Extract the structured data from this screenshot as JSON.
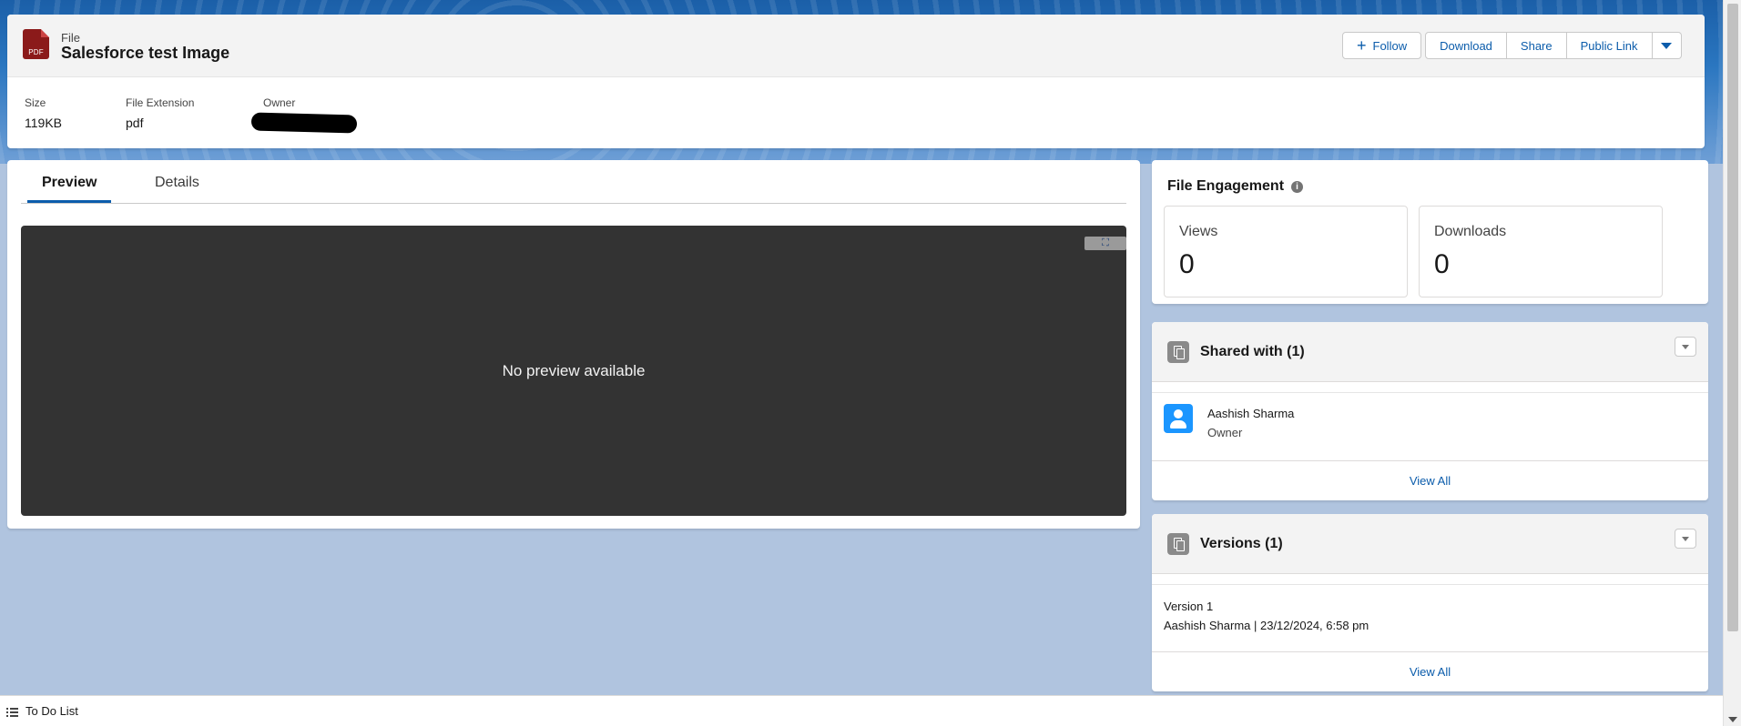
{
  "header": {
    "kicker": "File",
    "title": "Salesforce test Image",
    "file_icon_label": "PDF",
    "actions": {
      "follow": "Follow",
      "download": "Download",
      "share": "Share",
      "public_link": "Public Link"
    },
    "fields": {
      "size_label": "Size",
      "size_value": "119KB",
      "extension_label": "File Extension",
      "extension_value": "pdf",
      "owner_label": "Owner"
    }
  },
  "tabs": {
    "preview": "Preview",
    "details": "Details"
  },
  "preview": {
    "message": "No preview available"
  },
  "engagement": {
    "title": "File Engagement",
    "views_label": "Views",
    "views_value": "0",
    "downloads_label": "Downloads",
    "downloads_value": "0"
  },
  "shared": {
    "title": "Shared with (1)",
    "user_name": "Aashish Sharma",
    "user_role": "Owner",
    "view_all": "View All"
  },
  "versions": {
    "title": "Versions (1)",
    "line1": "Version 1",
    "line2": "Aashish Sharma | 23/12/2024, 6:58 pm",
    "view_all": "View All"
  },
  "utility": {
    "todo": "To Do List"
  },
  "colors": {
    "accent": "#0b5cab",
    "file_icon": "#8b1a1a",
    "avatar": "#1b96ff",
    "preview_bg": "#333333",
    "page_bg": "#b0c4df"
  },
  "icons": {
    "file": "pdf-file-icon",
    "follow": "plus-icon",
    "more": "chevron-down-icon",
    "info": "info-icon",
    "expand": "expand-icon",
    "related_list": "documents-icon",
    "user": "user-avatar-icon",
    "todo": "checklist-icon"
  }
}
